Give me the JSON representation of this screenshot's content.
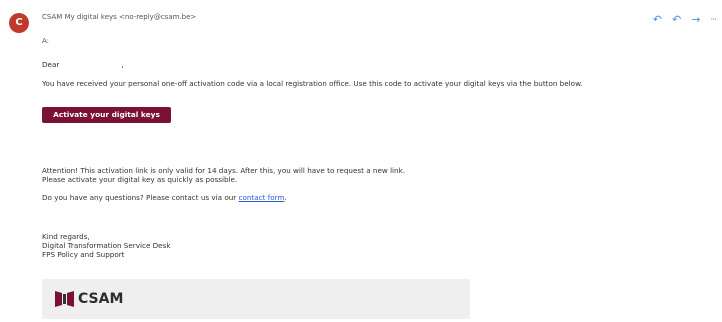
{
  "header": {
    "avatar_letter": "C",
    "sender": "CSAM My digital keys <no-reply@csam.be>",
    "to_label": "A:"
  },
  "actions": [
    {
      "name": "reply-icon",
      "glyph": "↶"
    },
    {
      "name": "reply-all-icon",
      "glyph": "↶"
    },
    {
      "name": "forward-icon",
      "glyph": "→"
    },
    {
      "name": "more-icon",
      "glyph": "···"
    }
  ],
  "body": {
    "greeting": "Dear",
    "greeting_suffix": ",",
    "intro": "You have received your personal one-off activation code via a local registration office. Use this code to activate your digital keys via the button below.",
    "button_label": "Activate your digital keys",
    "warning_line1": "Attention! This activation link is only valid for 14 days. After this, you will have to request a new link.",
    "warning_line2": "Please activate your digital key as quickly as possible.",
    "questions_prefix": "Do you have any questions? Please contact us via our",
    "questions_link": "contact form",
    "questions_suffix": ".",
    "signoff": "Kind regards,",
    "sig_line1": "Digital Transformation Service Desk",
    "sig_line2": "FPS Policy and Support"
  },
  "footer": {
    "logo_text": "CSAM"
  },
  "colors": {
    "brand": "#7a1236",
    "avatar": "#c0392b",
    "link": "#2a5bd7",
    "action": "#4a90d9"
  }
}
